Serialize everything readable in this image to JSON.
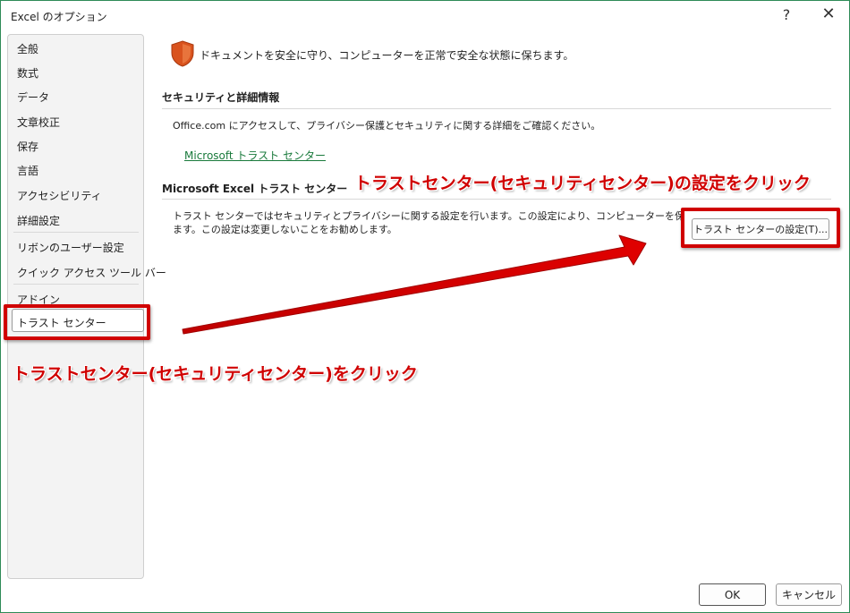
{
  "window": {
    "title": "Excel のオプション",
    "help_label": "?",
    "close_label": "✕"
  },
  "sidebar": {
    "items": [
      {
        "label": "全般"
      },
      {
        "label": "数式"
      },
      {
        "label": "データ"
      },
      {
        "label": "文章校正"
      },
      {
        "label": "保存"
      },
      {
        "label": "言語"
      },
      {
        "label": "アクセシビリティ"
      },
      {
        "label": "詳細設定"
      },
      {
        "label": "リボンのユーザー設定"
      },
      {
        "label": "クイック アクセス ツール バー"
      },
      {
        "label": "アドイン"
      },
      {
        "label": "トラスト センター"
      }
    ],
    "selected": "トラスト センター"
  },
  "main": {
    "intro": "ドキュメントを安全に守り、コンピューターを正常で安全な状態に保ちます。",
    "security_section": {
      "heading": "セキュリティと詳細情報",
      "text": "Office.com にアクセスして、プライバシー保護とセキュリティに関する詳細をご確認ください。",
      "link": "Microsoft トラスト センター"
    },
    "trust_section": {
      "heading": "Microsoft Excel トラスト センター",
      "text_line1": "トラスト センターではセキュリティとプライバシーに関する設定を行います。この設定により、コンピューターを保護することができ",
      "text_line2": "ます。この設定は変更しないことをお勧めします。",
      "button": "トラスト センターの設定(T)..."
    }
  },
  "annotations": {
    "top": "トラストセンター(セキュリティセンター)の設定をクリック",
    "bottom": "トラストセンター(セキュリティセンター)をクリック",
    "color": "#d00000"
  },
  "footer": {
    "ok": "OK",
    "cancel": "キャンセル"
  },
  "colors": {
    "link": "#1a7a3c",
    "shield": "#d9531e",
    "frame": "#2e8b57"
  }
}
